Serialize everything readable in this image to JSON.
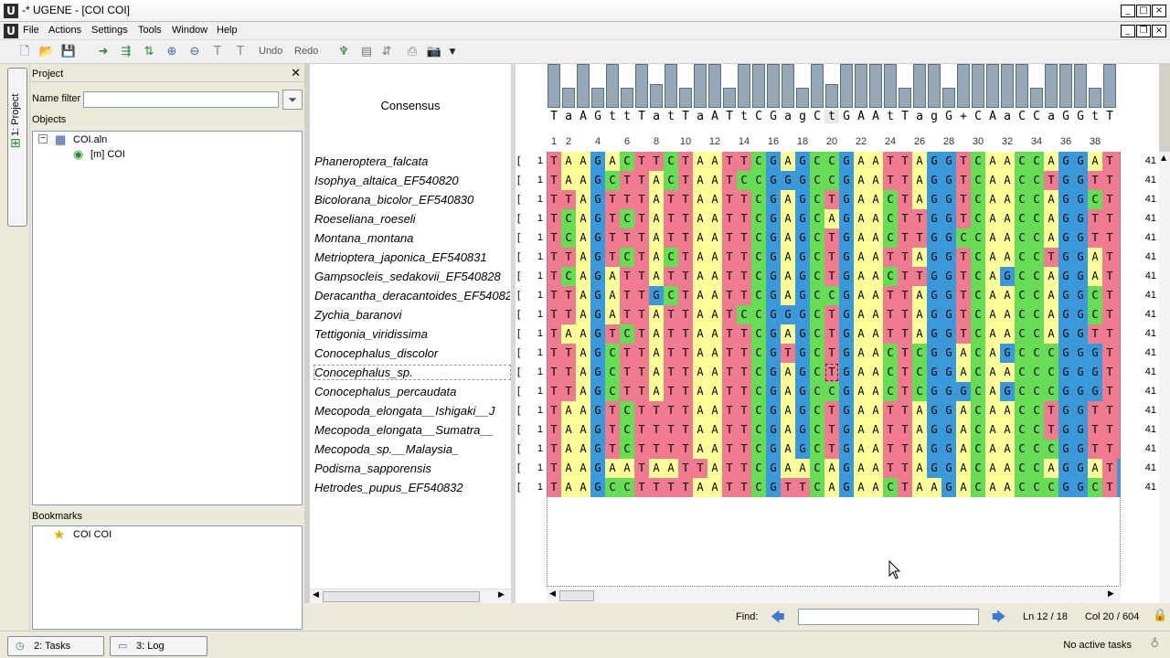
{
  "window": {
    "title": "-* UGENE - [COI COI]"
  },
  "menu": [
    "File",
    "Actions",
    "Settings",
    "Tools",
    "Window",
    "Help"
  ],
  "toolbar": {
    "undo": "Undo",
    "redo": "Redo"
  },
  "sidebar": {
    "project_tab": "1: Project"
  },
  "project": {
    "title": "Project",
    "name_filter_label": "Name filter",
    "objects_label": "Objects",
    "file": "COI.aln",
    "object": "[m] COI"
  },
  "bookmarks": {
    "label": "Bookmarks",
    "item": "COI COI"
  },
  "alignment": {
    "consensus_label": "Consensus",
    "consensus": "TaAGttTatTaATtCGagCtGAAtTagG+CAaCCaGGtT",
    "ruler": [
      "1",
      "2",
      "4",
      "6",
      "8",
      "10",
      "12",
      "14",
      "16",
      "18",
      "20",
      "22",
      "24",
      "26",
      "28",
      "30",
      "32",
      "34",
      "36",
      "38",
      "4"
    ],
    "histogram": [
      100,
      45,
      100,
      45,
      100,
      45,
      100,
      55,
      100,
      45,
      100,
      100,
      45,
      100,
      100,
      100,
      100,
      45,
      100,
      55,
      100,
      100,
      100,
      100,
      45,
      100,
      100,
      45,
      100,
      100,
      100,
      100,
      100,
      45,
      100,
      100,
      100,
      45,
      100
    ],
    "sequences": [
      {
        "name": "Phaneroptera_falcata",
        "offset": "1",
        "length": "41",
        "seq": "TAAGACTTCTAATTCGAGCCGAATTAGGTCAACCAGGATT"
      },
      {
        "name": "Isophya_altaica_EF540820",
        "offset": "1",
        "length": "41",
        "seq": "TAAGCTTACTAATCCGGGCCGAATTAGGTCAACCTGGTTT"
      },
      {
        "name": "Bicolorana_bicolor_EF540830",
        "offset": "1",
        "length": "41",
        "seq": "TTAGTTTATTAATTCGAGCTGAACTAGGTCAACCAGGCTT"
      },
      {
        "name": "Roeseliana_roeseli",
        "offset": "1",
        "length": "41",
        "seq": "TCAGTCTATTAATTCGAGCAGAACTTGGTCAACCAGGTTT"
      },
      {
        "name": "Montana_montana",
        "offset": "1",
        "length": "41",
        "seq": "TCAGTTTATTAATTCGAGCTGAACTTGGCCAACCAGGTTT"
      },
      {
        "name": "Metrioptera_japonica_EF540831",
        "offset": "1",
        "length": "41",
        "seq": "TTAGTCTACTAATTCGAGCTGAATTAGGTCAACCTGGATT"
      },
      {
        "name": "Gampsocleis_sedakovii_EF540828",
        "offset": "1",
        "length": "41",
        "seq": "TCAGATTATTAATTCGAGCTGAACTTGGTCAGCCAGGATT"
      },
      {
        "name": "Deracantha_deracantoides_EF540829",
        "offset": "1",
        "length": "41",
        "seq": "TTAGATTGCTAATTCGAGCCGAATTAGGTCAACCAGGCTT"
      },
      {
        "name": "Zychia_baranovi",
        "offset": "1",
        "length": "41",
        "seq": "TTAGATTATTAATCCGGGCTGAATTAGGTCAACCAGGCTT"
      },
      {
        "name": "Tettigonia_viridissima",
        "offset": "1",
        "length": "41",
        "seq": "TAAGTCTATTAATTCGAGCTGAATTAGGTCAACCAGGTTT"
      },
      {
        "name": "Conocephalus_discolor",
        "offset": "1",
        "length": "41",
        "seq": "TTAGCTTATTAATTCGTGCTGAACTCGGACAGCCCGGGTT"
      },
      {
        "name": "Conocephalus_sp.",
        "offset": "1",
        "length": "41",
        "seq": "TTAGCTTATTAATTCGAGCTGAACTCGGACAACCCGGGTT"
      },
      {
        "name": "Conocephalus_percaudata",
        "offset": "1",
        "length": "41",
        "seq": "TTAGCTTATTAATTCGAGCCGAACTCGGGCAGCCCGGGTT"
      },
      {
        "name": "Mecopoda_elongata__Ishigaki__J",
        "offset": "1",
        "length": "41",
        "seq": "TAAGTCTTTTAATTCGAGCTGAATTAGGACAACCTGGTTT"
      },
      {
        "name": "Mecopoda_elongata__Sumatra__",
        "offset": "1",
        "length": "41",
        "seq": "TAAGTCTTTTAATTCGAGCTGAATTAGGACAACCTGGTTT"
      },
      {
        "name": "Mecopoda_sp.__Malaysia_",
        "offset": "1",
        "length": "41",
        "seq": "TAAGTCTTTTAATTCGAGCTGAATTAGGACAACCCGGTTT"
      },
      {
        "name": "Podisma_sapporensis",
        "offset": "1",
        "length": "41",
        "seq": "TAAGAATAATTATTCGAACAGAATTAGGACAACCAGGATG"
      },
      {
        "name": "Hetrodes_pupus_EF540832",
        "offset": "1",
        "length": "41",
        "seq": "TAAGCCTTTTAATTCGTTCAGAACTAAGACAACCCGGCTG"
      }
    ]
  },
  "find": {
    "label": "Find:",
    "ln": "Ln 12 / 18",
    "col": "Col 20 / 604"
  },
  "status": {
    "tasks_tab": "2: Tasks",
    "log_tab": "3: Log",
    "no_tasks": "No active tasks"
  },
  "colors": {
    "A": "#ffff99",
    "C": "#66dd55",
    "G": "#3a9ad9",
    "T": "#f07a90",
    "hist": "#95a8ba"
  }
}
